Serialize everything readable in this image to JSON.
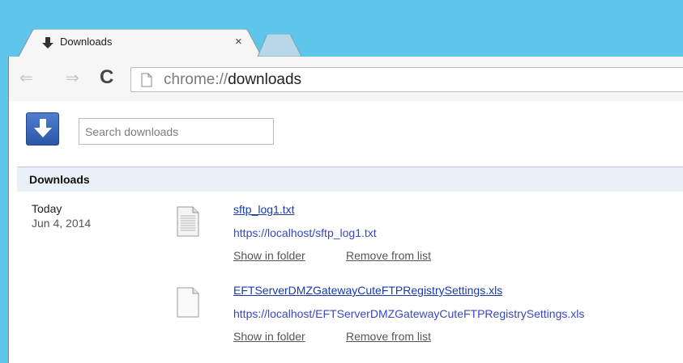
{
  "tab": {
    "title": "Downloads",
    "close_glyph": "×",
    "icon": "download-arrow-icon"
  },
  "toolbar": {
    "back_glyph": "⇐",
    "forward_glyph": "⇒",
    "reload_glyph": "C",
    "url_scheme": "chrome://",
    "url_path": "downloads"
  },
  "search": {
    "placeholder": "Search downloads",
    "value": ""
  },
  "section": {
    "title": "Downloads"
  },
  "date_group": {
    "label": "Today",
    "date": "Jun 4, 2014"
  },
  "downloads": [
    {
      "name": "sftp_log1.txt",
      "url": "https://localhost/sftp_log1.txt",
      "show_label": "Show in folder",
      "remove_label": "Remove from list",
      "icon": "text-file-icon"
    },
    {
      "name": "EFTServerDMZGatewayCuteFTPRegistrySettings.xls",
      "url": "https://localhost/EFTServerDMZGatewayCuteFTPRegistrySettings.xls",
      "show_label": "Show in folder",
      "remove_label": "Remove from list",
      "icon": "blank-file-icon"
    }
  ],
  "colors": {
    "titlebar": "#5ec6ea",
    "link": "#1a3aa8",
    "header_bg": "#eaf0f8",
    "logo": "#2c56a8"
  }
}
